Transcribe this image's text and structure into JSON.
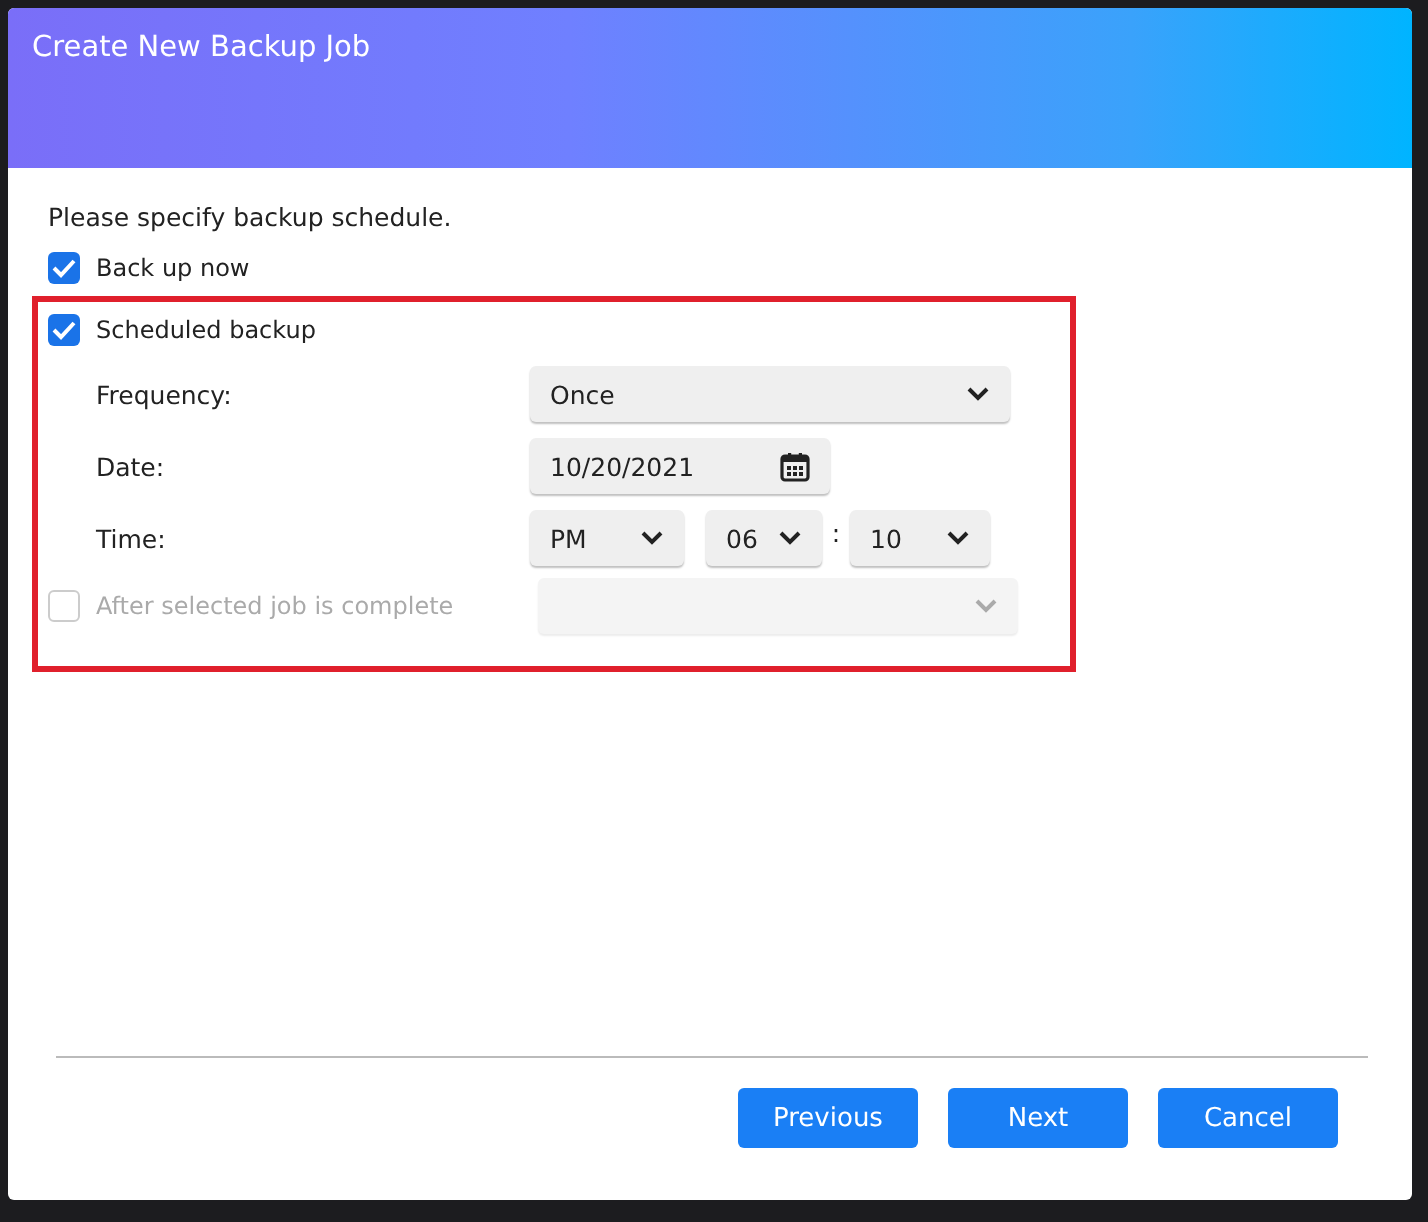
{
  "dialog": {
    "title": "Create New Backup Job"
  },
  "instruction": "Please specify backup schedule.",
  "backup_now": {
    "label": "Back up now",
    "checked": true,
    "disabled": false
  },
  "schedule": {
    "label": "Scheduled backup",
    "checked": true,
    "disabled": false,
    "fields": [
      {
        "kind": "select",
        "label": "Frequency:",
        "value": "Once"
      },
      {
        "kind": "date",
        "label": "Date:",
        "value": "10/20/2021"
      },
      {
        "kind": "time",
        "label": "Time:",
        "parts": [
          "PM",
          "06",
          "10"
        ],
        "separator": ":"
      }
    ],
    "after_job": {
      "label": "After selected job is complete",
      "checked": false,
      "disabled": true
    }
  },
  "buttons": [
    "Previous",
    "Next",
    "Cancel"
  ]
}
